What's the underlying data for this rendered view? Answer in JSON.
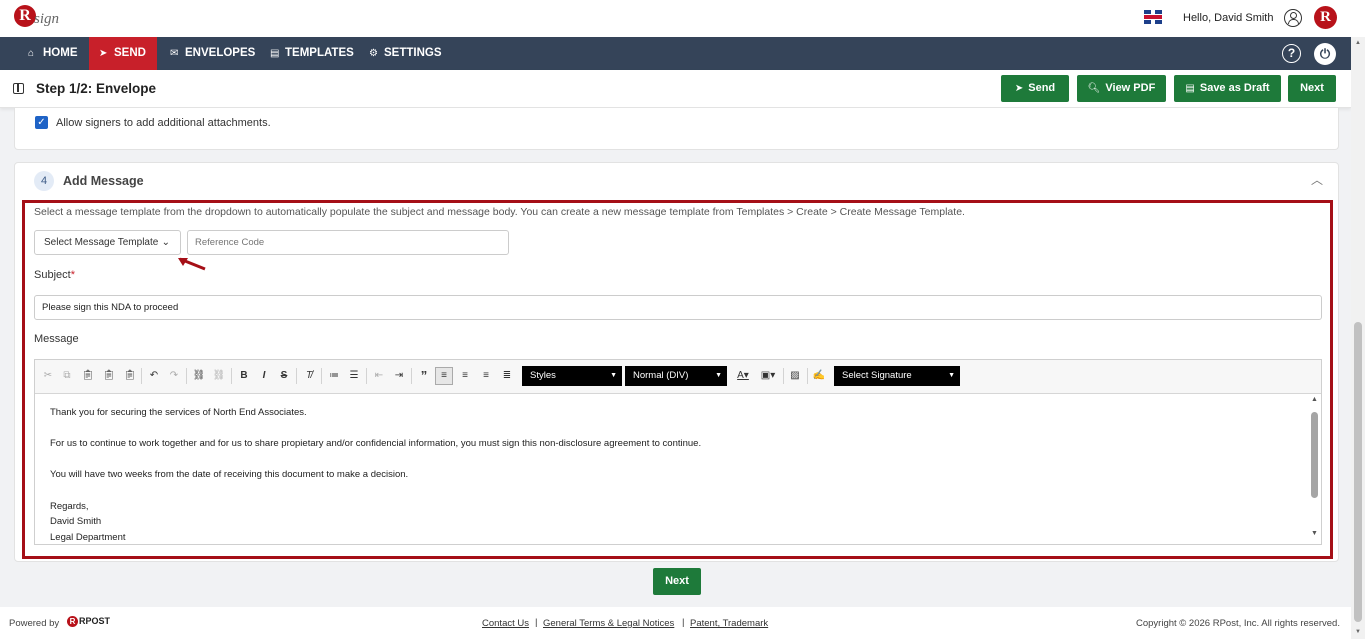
{
  "header": {
    "logo_text": "RSign",
    "greeting": "Hello, David Smith"
  },
  "nav": {
    "items": [
      {
        "label": "HOME",
        "icon": "home-icon"
      },
      {
        "label": "SEND",
        "icon": "send-icon"
      },
      {
        "label": "ENVELOPES",
        "icon": "envelope-icon"
      },
      {
        "label": "TEMPLATES",
        "icon": "document-icon"
      },
      {
        "label": "SETTINGS",
        "icon": "gear-icon"
      }
    ],
    "active": "SEND"
  },
  "step": {
    "title": "Step 1/2: Envelope",
    "buttons": {
      "send": "Send",
      "view_pdf": "View PDF",
      "save_draft": "Save as Draft",
      "next": "Next"
    }
  },
  "attachments": {
    "checkbox_label": "Allow signers to add additional attachments.",
    "checked": true
  },
  "message_section": {
    "number": "4",
    "title": "Add Message",
    "instructions": "Select a message template from the dropdown to automatically populate the subject and message body. You can create a new message template from Templates > Create > Create Message Template.",
    "template_select": "Select Message Template",
    "reference_placeholder": "Reference Code",
    "subject_label": "Subject",
    "subject_required": "*",
    "subject_value": "Please sign this NDA to proceed",
    "message_label": "Message",
    "toolbar": {
      "styles": "Styles",
      "format": "Normal (DIV)",
      "signature": "Select Signature"
    },
    "body_lines": [
      "Thank you for securing the services of North End Associates.",
      "For us to continue to work together and for us to share propietary and/or confidencial information, you must sign this non-disclosure agreement to continue.",
      "You will have two weeks from the date of receiving this document to make a decision.",
      "Regards,",
      "David Smith",
      "Legal Department"
    ]
  },
  "bottom_next": "Next",
  "footer": {
    "powered_by": "Powered by",
    "rpost": "RPOST",
    "links": [
      "Contact Us",
      "General Terms & Legal Notices",
      "Patent, Trademark"
    ],
    "separator": "|",
    "copyright": "Copyright © 2026 RPost, Inc. All rights reserved."
  },
  "colors": {
    "nav_bg": "#354459",
    "active_tab": "#c8202a",
    "primary_button": "#1e7a3a",
    "highlight_frame": "#a50f17"
  }
}
